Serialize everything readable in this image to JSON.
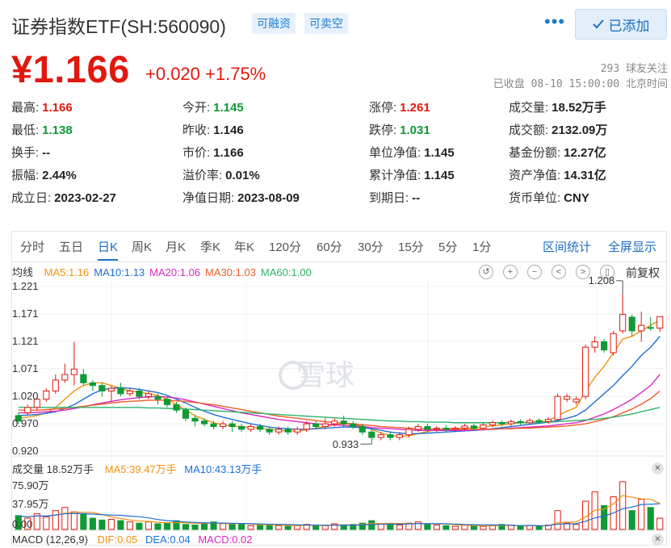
{
  "header": {
    "title": "证券指数ETF(SH:560090)",
    "tags": [
      "可融资",
      "可卖空"
    ],
    "more": "•••",
    "added_label": "已添加",
    "check_icon": "check-icon"
  },
  "quote": {
    "price": "¥1.166",
    "change": "+0.020  +1.75%",
    "followers": "293 球友关注",
    "status": "已收盘 08-10 15:00:00 北京时间"
  },
  "stats": [
    {
      "k": "最高:",
      "v": "1.166",
      "c": "up"
    },
    {
      "k": "今开:",
      "v": "1.145",
      "c": "down"
    },
    {
      "k": "涨停:",
      "v": "1.261",
      "c": "up"
    },
    {
      "k": "成交量:",
      "v": "18.52万手",
      "c": ""
    },
    {
      "k": "最低:",
      "v": "1.138",
      "c": "down"
    },
    {
      "k": "昨收:",
      "v": "1.146",
      "c": ""
    },
    {
      "k": "跌停:",
      "v": "1.031",
      "c": "down"
    },
    {
      "k": "成交额:",
      "v": "2132.09万",
      "c": ""
    },
    {
      "k": "换手:",
      "v": "--",
      "c": ""
    },
    {
      "k": "市价:",
      "v": "1.166",
      "c": ""
    },
    {
      "k": "单位净值:",
      "v": "1.145",
      "c": ""
    },
    {
      "k": "基金份额:",
      "v": "12.27亿",
      "c": ""
    },
    {
      "k": "振幅:",
      "v": "2.44%",
      "c": ""
    },
    {
      "k": "溢价率:",
      "v": "0.01%",
      "c": ""
    },
    {
      "k": "累计净值:",
      "v": "1.145",
      "c": ""
    },
    {
      "k": "资产净值:",
      "v": "14.31亿",
      "c": ""
    },
    {
      "k": "成立日:",
      "v": "2023-02-27",
      "c": ""
    },
    {
      "k": "净值日期:",
      "v": "2023-08-09",
      "c": ""
    },
    {
      "k": "到期日:",
      "v": "--",
      "c": ""
    },
    {
      "k": "货币单位:",
      "v": "CNY",
      "c": ""
    }
  ],
  "tabs": {
    "items": [
      "分时",
      "五日",
      "日K",
      "周K",
      "月K",
      "季K",
      "年K",
      "120分",
      "60分",
      "30分",
      "15分",
      "5分",
      "1分"
    ],
    "active": "日K",
    "range_stats": "区间统计",
    "fullscreen": "全屏显示"
  },
  "ma_legend": {
    "label": "均线",
    "items": [
      {
        "text": "MA5:1.16",
        "color": "#f29111"
      },
      {
        "text": "MA10:1.13",
        "color": "#1e6fd6"
      },
      {
        "text": "MA20:1.06",
        "color": "#d928c4"
      },
      {
        "text": "MA30:1.03",
        "color": "#f05d2a"
      },
      {
        "text": "MA60:1.00",
        "color": "#2cb36b"
      }
    ],
    "controls": [
      "↺",
      "+",
      "−",
      "<",
      ">",
      "▯"
    ],
    "adjust": "前复权"
  },
  "price_axis": [
    "1.221",
    "1.171",
    "1.121",
    "1.071",
    "1.020",
    "0.970",
    "0.920"
  ],
  "markers": {
    "high": "1.208",
    "low": "0.933"
  },
  "watermark": "雪球",
  "volume": {
    "label": "成交量 18.52万手",
    "ma5": "MA5:39.47万手",
    "ma10": "MA10:43.13万手",
    "axis": [
      "75.90万",
      "37.95万",
      "0.00"
    ]
  },
  "macd": {
    "label": "MACD (12,26,9)",
    "dif": "DIF:0.05",
    "dea": "DEA:0.04",
    "macd": "MACD:0.02"
  },
  "colors": {
    "up": "#e0190f",
    "down": "#0e9a35",
    "accent": "#1b6ec2"
  },
  "chart_data": {
    "type": "candlestick",
    "ylim": [
      0.92,
      1.221
    ],
    "candles": [
      [
        0.985,
        0.975,
        0.99,
        0.97
      ],
      [
        0.99,
        1.0,
        1.005,
        0.985
      ],
      [
        1.0,
        1.015,
        1.02,
        0.995
      ],
      [
        1.015,
        1.03,
        1.035,
        1.01
      ],
      [
        1.03,
        1.05,
        1.06,
        1.025
      ],
      [
        1.05,
        1.06,
        1.08,
        1.045
      ],
      [
        1.06,
        1.07,
        1.12,
        1.04
      ],
      [
        1.06,
        1.045,
        1.07,
        1.04
      ],
      [
        1.045,
        1.04,
        1.05,
        1.03
      ],
      [
        1.04,
        1.03,
        1.045,
        1.02
      ],
      [
        1.03,
        1.035,
        1.04,
        1.01
      ],
      [
        1.035,
        1.025,
        1.045,
        1.02
      ],
      [
        1.025,
        1.03,
        1.035,
        1.02
      ],
      [
        1.03,
        1.02,
        1.035,
        1.015
      ],
      [
        1.02,
        1.025,
        1.03,
        1.015
      ],
      [
        1.02,
        1.015,
        1.025,
        1.005
      ],
      [
        1.015,
        1.005,
        1.02,
        1.0
      ],
      [
        1.005,
        0.995,
        1.01,
        0.99
      ],
      [
        0.995,
        0.98,
        1.0,
        0.975
      ],
      [
        0.98,
        0.975,
        0.985,
        0.965
      ],
      [
        0.975,
        0.97,
        0.98,
        0.965
      ],
      [
        0.97,
        0.965,
        0.975,
        0.96
      ],
      [
        0.965,
        0.97,
        0.975,
        0.96
      ],
      [
        0.97,
        0.965,
        0.975,
        0.955
      ],
      [
        0.965,
        0.96,
        0.97,
        0.955
      ],
      [
        0.96,
        0.965,
        0.97,
        0.955
      ],
      [
        0.965,
        0.96,
        0.97,
        0.955
      ],
      [
        0.96,
        0.955,
        0.965,
        0.95
      ],
      [
        0.955,
        0.96,
        0.965,
        0.95
      ],
      [
        0.96,
        0.955,
        0.965,
        0.95
      ],
      [
        0.955,
        0.96,
        0.965,
        0.95
      ],
      [
        0.96,
        0.97,
        0.975,
        0.955
      ],
      [
        0.97,
        0.965,
        0.975,
        0.96
      ],
      [
        0.965,
        0.97,
        0.98,
        0.96
      ],
      [
        0.97,
        0.975,
        0.98,
        0.965
      ],
      [
        0.975,
        0.97,
        0.985,
        0.965
      ],
      [
        0.97,
        0.965,
        0.975,
        0.96
      ],
      [
        0.965,
        0.955,
        0.97,
        0.95
      ],
      [
        0.955,
        0.945,
        0.96,
        0.933
      ],
      [
        0.945,
        0.95,
        0.955,
        0.94
      ],
      [
        0.95,
        0.945,
        0.955,
        0.94
      ],
      [
        0.945,
        0.95,
        0.955,
        0.94
      ],
      [
        0.95,
        0.96,
        0.965,
        0.945
      ],
      [
        0.96,
        0.965,
        0.97,
        0.955
      ],
      [
        0.965,
        0.96,
        0.97,
        0.955
      ],
      [
        0.96,
        0.962,
        0.966,
        0.955
      ],
      [
        0.962,
        0.96,
        0.968,
        0.956
      ],
      [
        0.96,
        0.962,
        0.966,
        0.956
      ],
      [
        0.962,
        0.966,
        0.97,
        0.958
      ],
      [
        0.966,
        0.962,
        0.97,
        0.958
      ],
      [
        0.962,
        0.968,
        0.972,
        0.96
      ],
      [
        0.968,
        0.972,
        0.976,
        0.964
      ],
      [
        0.972,
        0.97,
        0.976,
        0.966
      ],
      [
        0.97,
        0.974,
        0.978,
        0.966
      ],
      [
        0.974,
        0.972,
        0.978,
        0.968
      ],
      [
        0.972,
        0.976,
        0.98,
        0.968
      ],
      [
        0.976,
        0.974,
        0.98,
        0.97
      ],
      [
        0.974,
        0.978,
        0.982,
        0.97
      ],
      [
        0.978,
        1.02,
        1.025,
        0.975
      ],
      [
        1.015,
        1.02,
        1.025,
        1.01
      ],
      [
        1.01,
        1.015,
        1.02,
        1.005
      ],
      [
        1.02,
        1.11,
        1.115,
        1.015
      ],
      [
        1.11,
        1.12,
        1.13,
        1.1
      ],
      [
        1.12,
        1.105,
        1.125,
        1.1
      ],
      [
        1.1,
        1.135,
        1.14,
        1.095
      ],
      [
        1.14,
        1.17,
        1.208,
        1.135
      ],
      [
        1.165,
        1.14,
        1.17,
        1.13
      ],
      [
        1.14,
        1.15,
        1.175,
        1.12
      ],
      [
        1.146,
        1.145,
        1.165,
        1.14
      ],
      [
        1.145,
        1.166,
        1.166,
        1.138
      ]
    ],
    "volume": [
      22,
      18,
      25,
      20,
      30,
      35,
      28,
      24,
      18,
      15,
      16,
      14,
      12,
      10,
      12,
      9,
      10,
      14,
      8,
      7,
      10,
      12,
      9,
      8,
      8,
      6,
      7,
      8,
      6,
      5,
      6,
      8,
      7,
      6,
      9,
      6,
      8,
      10,
      14,
      9,
      8,
      7,
      10,
      12,
      8,
      7,
      6,
      5,
      7,
      6,
      5,
      6,
      8,
      7,
      5,
      6,
      5,
      7,
      30,
      10,
      8,
      45,
      60,
      38,
      52,
      76,
      30,
      48,
      35,
      18
    ],
    "ma5": [
      0.98,
      0.982,
      0.985,
      0.99,
      1.0,
      1.015,
      1.03,
      1.04,
      1.045,
      1.045,
      1.04,
      1.035,
      1.03,
      1.028,
      1.025,
      1.022,
      1.015,
      1.005,
      0.995,
      0.985,
      0.978,
      0.972,
      0.968,
      0.966,
      0.965,
      0.963,
      0.962,
      0.96,
      0.958,
      0.957,
      0.957,
      0.959,
      0.962,
      0.965,
      0.968,
      0.97,
      0.969,
      0.966,
      0.96,
      0.953,
      0.949,
      0.947,
      0.948,
      0.952,
      0.956,
      0.959,
      0.961,
      0.962,
      0.962,
      0.963,
      0.964,
      0.966,
      0.968,
      0.97,
      0.972,
      0.973,
      0.974,
      0.975,
      0.985,
      0.993,
      1.0,
      1.03,
      1.055,
      1.075,
      1.1,
      1.125,
      1.13,
      1.14,
      1.15,
      1.16
    ],
    "ma10": [
      0.985,
      0.986,
      0.987,
      0.989,
      0.992,
      0.998,
      1.005,
      1.015,
      1.025,
      1.032,
      1.035,
      1.036,
      1.035,
      1.033,
      1.03,
      1.027,
      1.022,
      1.015,
      1.008,
      1.0,
      0.993,
      0.987,
      0.982,
      0.978,
      0.974,
      0.97,
      0.967,
      0.964,
      0.962,
      0.961,
      0.96,
      0.96,
      0.961,
      0.962,
      0.963,
      0.964,
      0.964,
      0.963,
      0.961,
      0.958,
      0.955,
      0.953,
      0.952,
      0.952,
      0.953,
      0.954,
      0.955,
      0.956,
      0.957,
      0.958,
      0.959,
      0.961,
      0.963,
      0.965,
      0.967,
      0.969,
      0.971,
      0.973,
      0.976,
      0.98,
      0.985,
      0.995,
      1.01,
      1.025,
      1.04,
      1.058,
      1.075,
      1.095,
      1.11,
      1.13
    ],
    "ma20": [
      0.99,
      0.99,
      0.991,
      0.992,
      0.993,
      0.995,
      0.998,
      1.001,
      1.005,
      1.008,
      1.011,
      1.014,
      1.016,
      1.018,
      1.019,
      1.02,
      1.019,
      1.017,
      1.014,
      1.01,
      1.006,
      1.002,
      0.998,
      0.994,
      0.99,
      0.987,
      0.984,
      0.981,
      0.978,
      0.976,
      0.974,
      0.972,
      0.97,
      0.969,
      0.968,
      0.967,
      0.966,
      0.965,
      0.963,
      0.962,
      0.961,
      0.96,
      0.959,
      0.958,
      0.958,
      0.958,
      0.958,
      0.958,
      0.958,
      0.959,
      0.959,
      0.96,
      0.961,
      0.962,
      0.963,
      0.964,
      0.965,
      0.966,
      0.968,
      0.97,
      0.972,
      0.976,
      0.982,
      0.988,
      0.996,
      1.005,
      1.015,
      1.027,
      1.04,
      1.06
    ],
    "ma30": [
      0.995,
      0.995,
      0.995,
      0.996,
      0.997,
      0.998,
      1.0,
      1.002,
      1.004,
      1.006,
      1.008,
      1.01,
      1.011,
      1.012,
      1.013,
      1.013,
      1.013,
      1.012,
      1.011,
      1.009,
      1.007,
      1.005,
      1.002,
      0.999,
      0.996,
      0.993,
      0.99,
      0.987,
      0.984,
      0.982,
      0.98,
      0.978,
      0.976,
      0.974,
      0.972,
      0.971,
      0.97,
      0.968,
      0.967,
      0.965,
      0.964,
      0.963,
      0.962,
      0.961,
      0.961,
      0.96,
      0.96,
      0.96,
      0.96,
      0.96,
      0.96,
      0.96,
      0.961,
      0.961,
      0.962,
      0.962,
      0.963,
      0.964,
      0.965,
      0.966,
      0.968,
      0.97,
      0.974,
      0.978,
      0.983,
      0.99,
      0.997,
      1.006,
      1.016,
      1.03
    ],
    "ma60": [
      1.0,
      1.0,
      1.0,
      1.0,
      1.0,
      1.0,
      1.0,
      1.0,
      1.0,
      1.0,
      1.0,
      1.0,
      1.0,
      1.0,
      0.999,
      0.999,
      0.998,
      0.998,
      0.997,
      0.996,
      0.995,
      0.994,
      0.993,
      0.992,
      0.991,
      0.99,
      0.989,
      0.988,
      0.987,
      0.986,
      0.985,
      0.984,
      0.983,
      0.982,
      0.981,
      0.98,
      0.979,
      0.978,
      0.977,
      0.976,
      0.975,
      0.975,
      0.974,
      0.974,
      0.973,
      0.973,
      0.973,
      0.972,
      0.972,
      0.972,
      0.972,
      0.972,
      0.972,
      0.972,
      0.972,
      0.972,
      0.973,
      0.973,
      0.974,
      0.975,
      0.976,
      0.977,
      0.978,
      0.98,
      0.982,
      0.985,
      0.988,
      0.992,
      0.996,
      1.0
    ]
  }
}
